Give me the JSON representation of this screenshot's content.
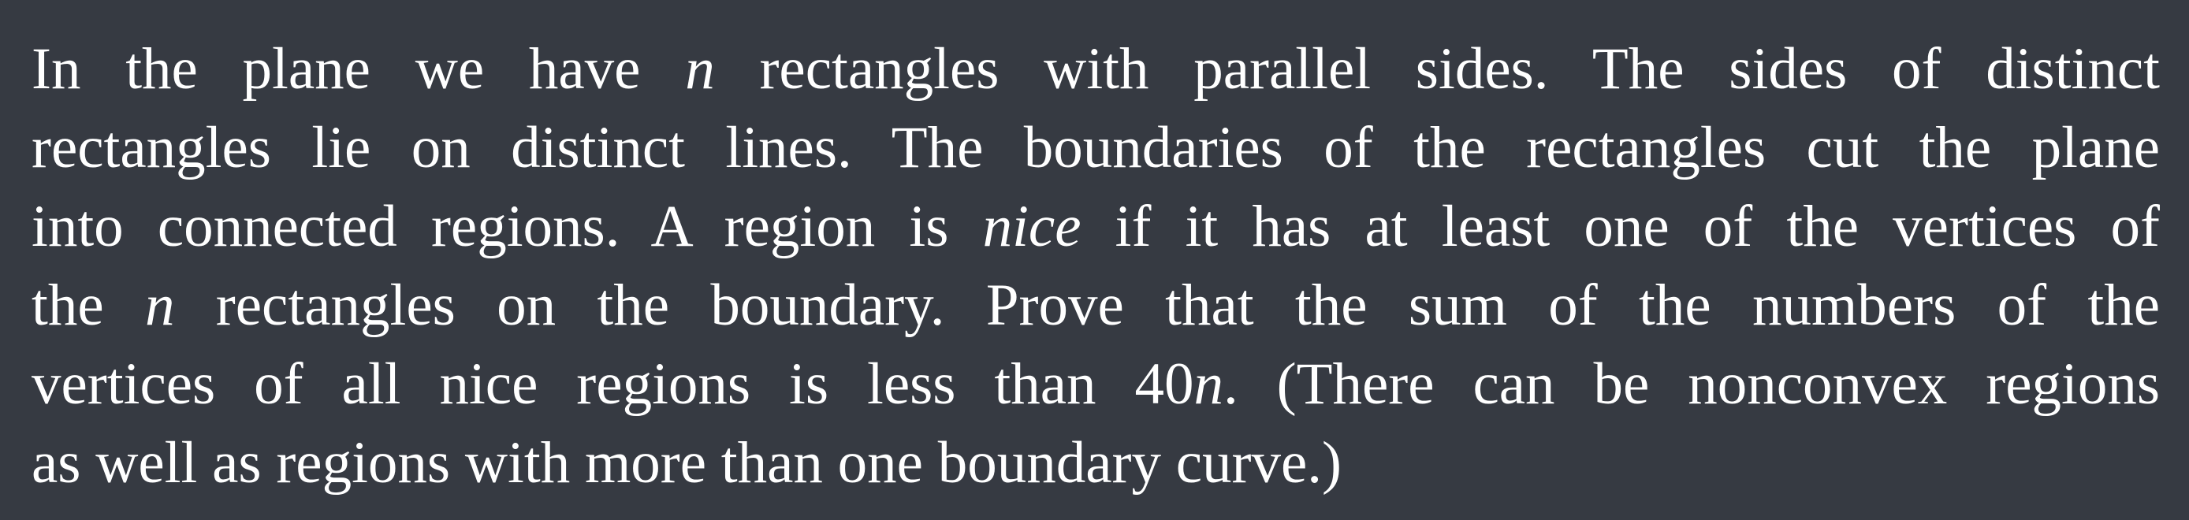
{
  "problem": {
    "lines": [
      {
        "seg1": "In the plane we have",
        "var_n": "n",
        "seg2": "rectangles with parallel sides. The sides of distinct"
      },
      {
        "text": "rectangles lie on distinct lines. The boundaries of the rectangles cut the plane"
      },
      {
        "seg1": "into connected regions. A region is",
        "em": "nice",
        "seg2": "if it has at least one of the vertices of"
      },
      {
        "seg1": "the",
        "var_n": "n",
        "seg2": "rectangles on the boundary. Prove that the sum of the numbers of the"
      },
      {
        "seg1": "vertices of all nice regions is less than 40",
        "var_n": "n",
        "seg2": ". (There can be nonconvex regions"
      },
      {
        "text": "as well as regions with more than one boundary curve.)"
      }
    ]
  }
}
